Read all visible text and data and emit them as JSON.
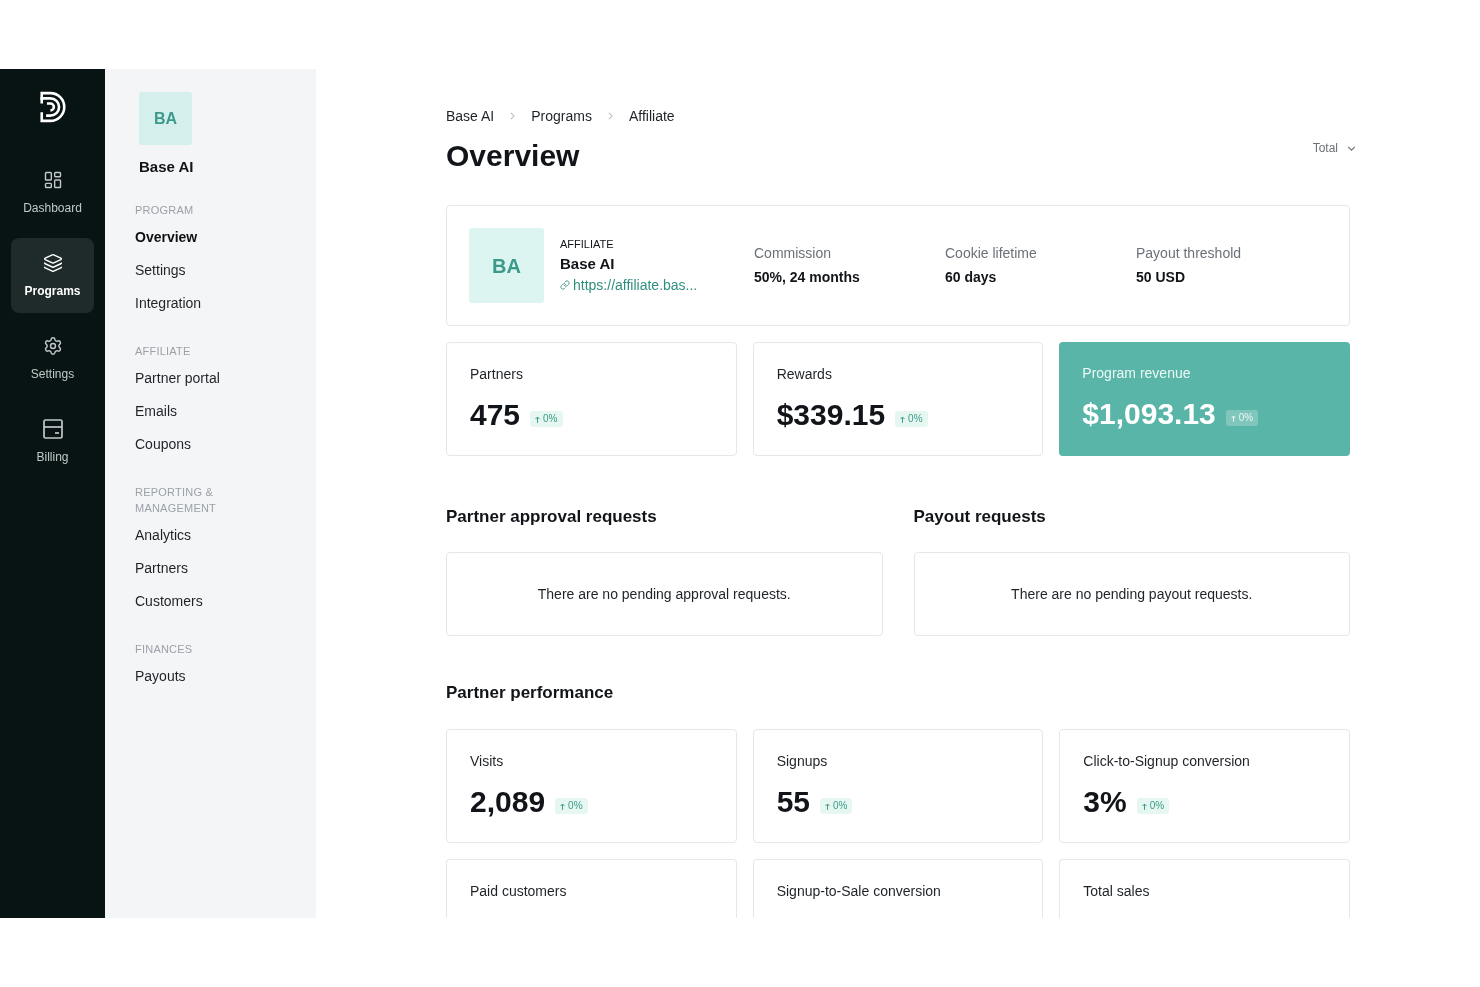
{
  "nav_rail": {
    "items": [
      {
        "label": "Dashboard",
        "selected": false
      },
      {
        "label": "Programs",
        "selected": true
      },
      {
        "label": "Settings",
        "selected": false
      },
      {
        "label": "Billing",
        "selected": false
      }
    ]
  },
  "program_sidebar": {
    "avatar": "BA",
    "name": "Base AI",
    "sections": [
      {
        "heading": "PROGRAM",
        "items": [
          {
            "label": "Overview",
            "selected": true
          },
          {
            "label": "Settings",
            "selected": false
          },
          {
            "label": "Integration",
            "selected": false
          }
        ]
      },
      {
        "heading": "AFFILIATE",
        "items": [
          {
            "label": "Partner portal",
            "selected": false
          },
          {
            "label": "Emails",
            "selected": false
          },
          {
            "label": "Coupons",
            "selected": false
          }
        ]
      },
      {
        "heading": "REPORTING & MANAGEMENT",
        "items": [
          {
            "label": "Analytics",
            "selected": false
          },
          {
            "label": "Partners",
            "selected": false
          },
          {
            "label": "Customers",
            "selected": false
          }
        ]
      },
      {
        "heading": "FINANCES",
        "items": [
          {
            "label": "Payouts",
            "selected": false
          }
        ]
      }
    ]
  },
  "breadcrumb": [
    "Base AI",
    "Programs",
    "Affiliate"
  ],
  "page_title": "Overview",
  "period_select": {
    "value": "Total"
  },
  "program_card": {
    "avatar": "BA",
    "type": "AFFILIATE",
    "name": "Base AI",
    "link": "https://affiliate.bas...",
    "details": [
      {
        "label": "Commission",
        "value": "50%, 24 months"
      },
      {
        "label": "Cookie lifetime",
        "value": "60 days"
      },
      {
        "label": "Payout threshold",
        "value": "50 USD"
      }
    ]
  },
  "summary_stats": [
    {
      "label": "Partners",
      "value": "475",
      "change": "0%",
      "highlighted": false
    },
    {
      "label": "Rewards",
      "value": "$339.15",
      "change": "0%",
      "highlighted": false
    },
    {
      "label": "Program revenue",
      "value": "$1,093.13",
      "change": "0%",
      "highlighted": true
    }
  ],
  "requests": [
    {
      "title": "Partner approval requests",
      "message": "There are no pending approval requests."
    },
    {
      "title": "Payout requests",
      "message": "There are no pending payout requests."
    }
  ],
  "performance": {
    "title": "Partner performance",
    "stats": [
      {
        "label": "Visits",
        "value": "2,089",
        "change": "0%"
      },
      {
        "label": "Signups",
        "value": "55",
        "change": "0%"
      },
      {
        "label": "Click-to-Signup conversion",
        "value": "3%",
        "change": "0%"
      },
      {
        "label": "Paid customers"
      },
      {
        "label": "Signup-to-Sale conversion"
      },
      {
        "label": "Total sales"
      }
    ]
  }
}
